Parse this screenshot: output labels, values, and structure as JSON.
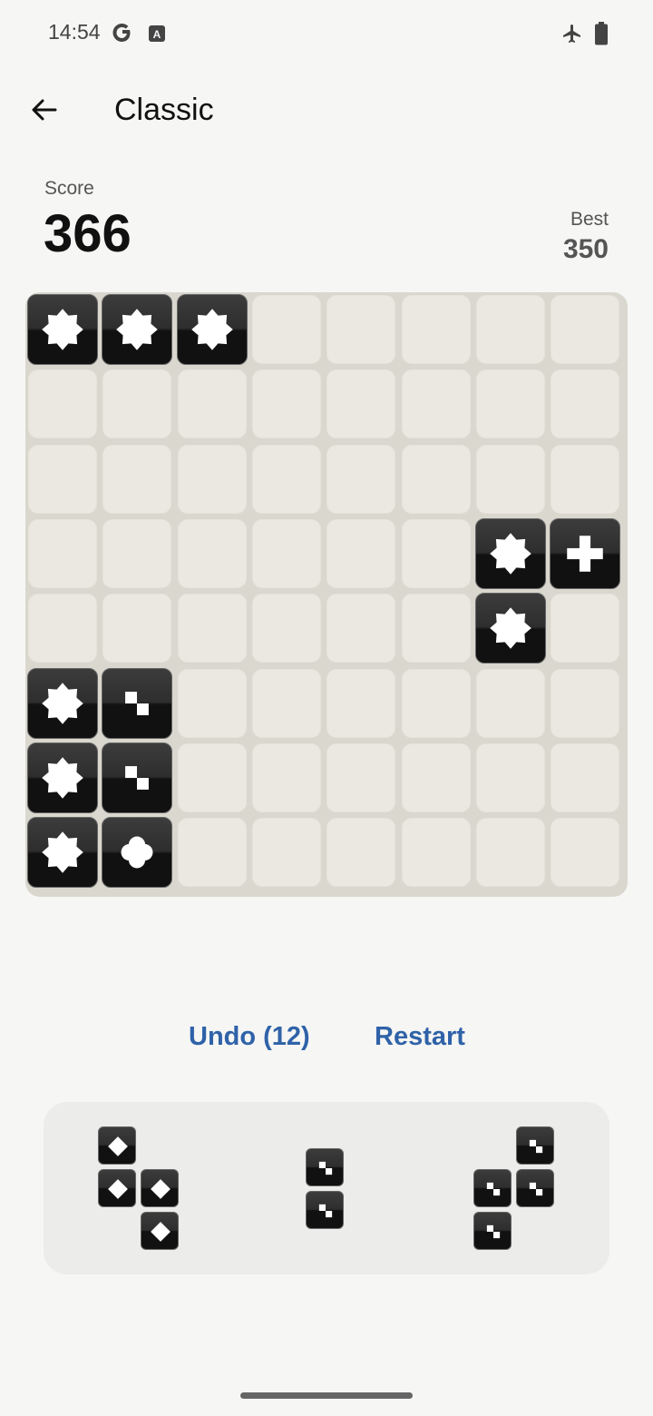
{
  "status_bar": {
    "time": "14:54",
    "icons": [
      "google-icon",
      "text-recognition-icon",
      "airplane-mode-icon",
      "battery-icon"
    ]
  },
  "header": {
    "title": "Classic",
    "back_icon": "back-arrow-icon"
  },
  "score": {
    "label": "Score",
    "value": "366"
  },
  "best": {
    "label": "Best",
    "value": "350"
  },
  "board": {
    "size": 8,
    "tiles": [
      {
        "row": 0,
        "col": 0,
        "symbol": "star"
      },
      {
        "row": 0,
        "col": 1,
        "symbol": "star"
      },
      {
        "row": 0,
        "col": 2,
        "symbol": "star"
      },
      {
        "row": 3,
        "col": 6,
        "symbol": "star"
      },
      {
        "row": 3,
        "col": 7,
        "symbol": "plus"
      },
      {
        "row": 4,
        "col": 6,
        "symbol": "star"
      },
      {
        "row": 5,
        "col": 0,
        "symbol": "star"
      },
      {
        "row": 5,
        "col": 1,
        "symbol": "steps"
      },
      {
        "row": 6,
        "col": 0,
        "symbol": "star"
      },
      {
        "row": 6,
        "col": 1,
        "symbol": "steps"
      },
      {
        "row": 7,
        "col": 0,
        "symbol": "star"
      },
      {
        "row": 7,
        "col": 1,
        "symbol": "clover"
      }
    ]
  },
  "controls": {
    "undo_label": "Undo (12)",
    "restart_label": "Restart"
  },
  "pieces": [
    {
      "symbol": "diamond",
      "cells": [
        [
          0,
          0
        ],
        [
          1,
          0
        ],
        [
          1,
          1
        ],
        [
          2,
          1
        ]
      ]
    },
    {
      "symbol": "steps",
      "cells": [
        [
          0,
          0
        ],
        [
          1,
          0
        ]
      ]
    },
    {
      "symbol": "steps",
      "cells": [
        [
          0,
          1
        ],
        [
          1,
          0
        ],
        [
          1,
          1
        ],
        [
          2,
          0
        ]
      ]
    }
  ],
  "colors": {
    "accent": "#2f62a8",
    "board": "#d9d7ce",
    "cell": "#ebe8e1",
    "tile": "#111111"
  }
}
